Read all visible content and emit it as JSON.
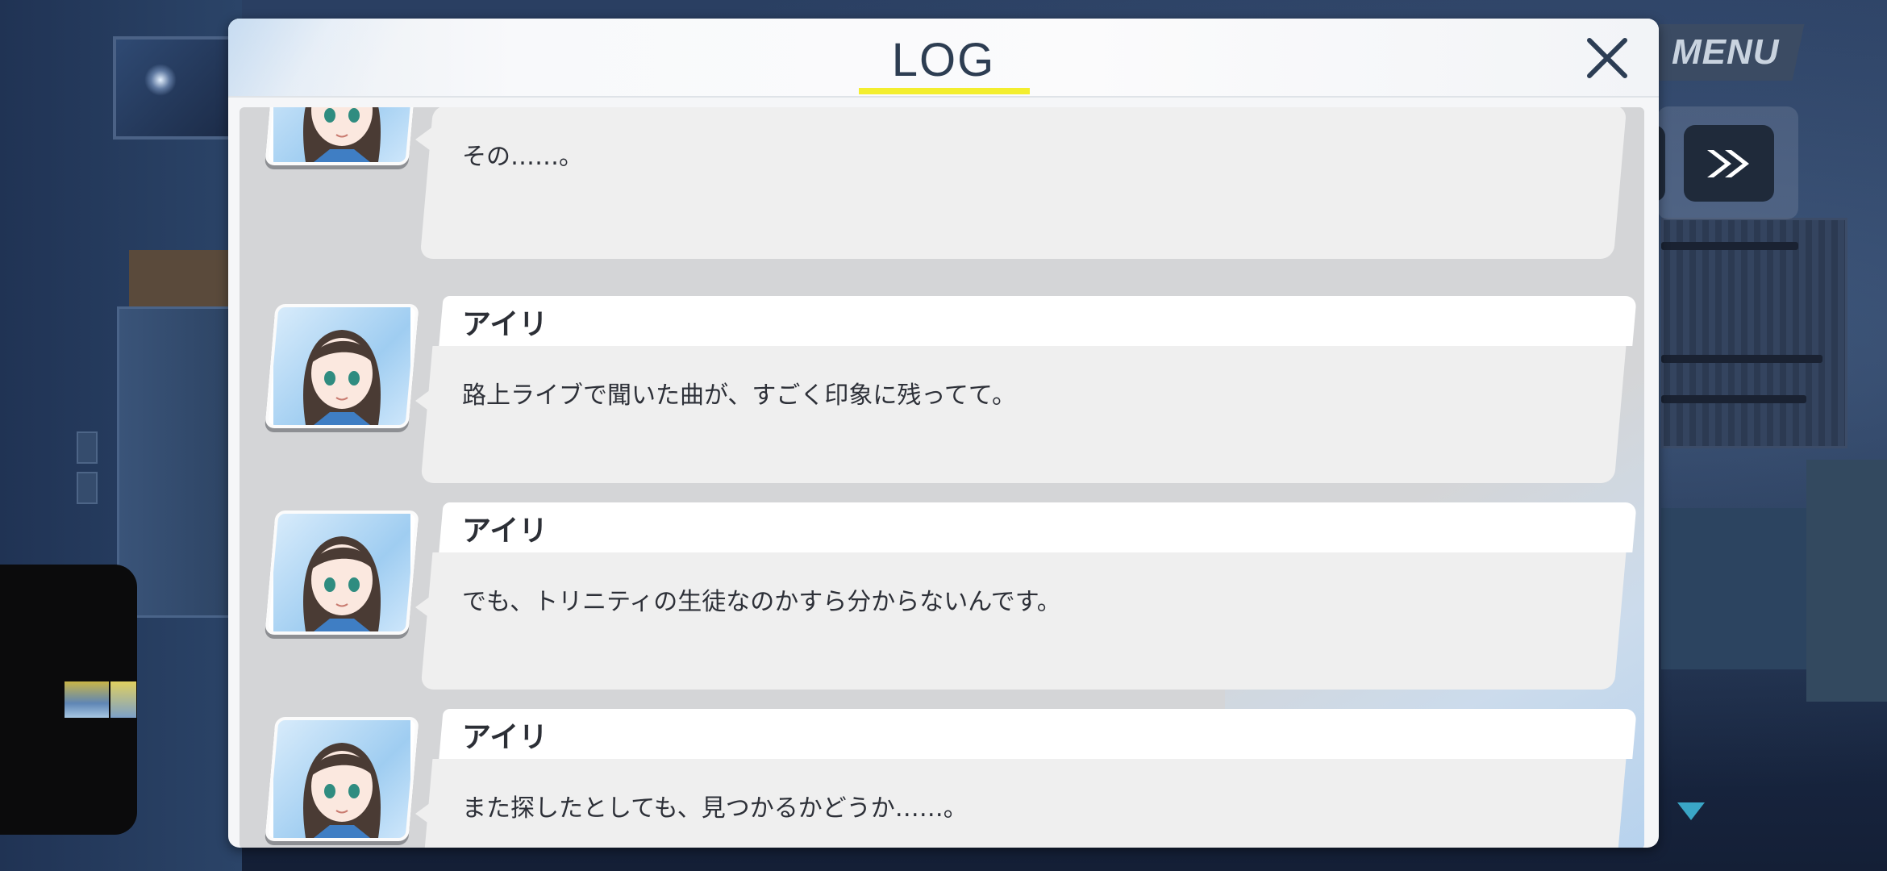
{
  "app": {
    "menu_label": "MENU",
    "skip_icon": "fast-forward-icon",
    "scroll_indicator": "down-triangle-icon"
  },
  "log": {
    "title": "LOG",
    "close_icon": "close-icon",
    "accent_color": "#f3ee2f",
    "entries": [
      {
        "speaker": "",
        "text": "その……。"
      },
      {
        "speaker": "アイリ",
        "text": "路上ライブで聞いた曲が、すごく印象に残ってて。"
      },
      {
        "speaker": "アイリ",
        "text": "でも、トリニティの生徒なのかすら分からないんです。"
      },
      {
        "speaker": "アイリ",
        "text": "また探したとしても、見つかるかどうか……。"
      }
    ]
  }
}
